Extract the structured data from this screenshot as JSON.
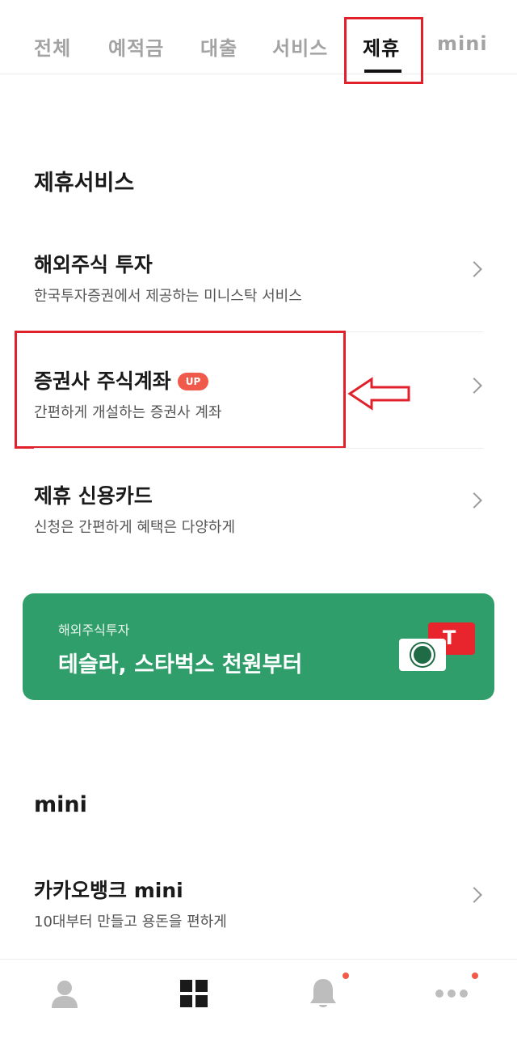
{
  "tabs": [
    {
      "label": "전체",
      "active": false
    },
    {
      "label": "예적금",
      "active": false
    },
    {
      "label": "대출",
      "active": false
    },
    {
      "label": "서비스",
      "active": false
    },
    {
      "label": "제휴",
      "active": true
    },
    {
      "label": "mini",
      "active": false
    }
  ],
  "partner_section": {
    "title": "제휴서비스",
    "items": [
      {
        "title": "해외주식 투자",
        "subtitle": "한국투자증권에서 제공하는 미니스탁 서비스"
      },
      {
        "title": "증권사 주식계좌",
        "badge": "UP",
        "subtitle": "간편하게 개설하는 증권사 계좌"
      },
      {
        "title": "제휴 신용카드",
        "subtitle": "신청은 간편하게 혜택은 다양하게"
      }
    ]
  },
  "banner": {
    "subtitle": "해외주식투자",
    "title": "테슬라, 스타벅스 천원부터",
    "color": "#2f9e6b",
    "icons": [
      "tesla-card-icon",
      "starbucks-card-icon"
    ]
  },
  "mini_section": {
    "title": "mini",
    "items": [
      {
        "title": "카카오뱅크 mini",
        "subtitle": "10대부터 만들고 용돈을 편하게"
      }
    ]
  },
  "bottom_nav": [
    {
      "icon": "person-icon",
      "has_dot": false
    },
    {
      "icon": "grid-icon",
      "has_dot": false,
      "active": true
    },
    {
      "icon": "bell-icon",
      "has_dot": true
    },
    {
      "icon": "more-icon",
      "has_dot": true
    }
  ],
  "colors": {
    "accent_red": "#e0202a",
    "badge": "#f05a4a",
    "banner_green": "#2f9e6b"
  }
}
